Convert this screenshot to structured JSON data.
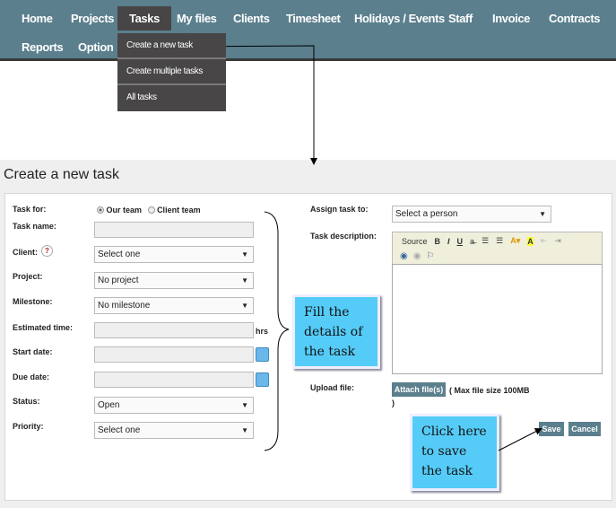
{
  "nav": {
    "items": [
      "Home",
      "Projects",
      "Tasks",
      "My files",
      "Clients",
      "Timesheet",
      "Holidays / Events",
      "Staff",
      "Invoice",
      "Contracts",
      "Reports",
      "Option"
    ],
    "active": "Tasks",
    "dropdown": [
      "Create a new task",
      "Create multiple tasks",
      "All tasks"
    ]
  },
  "page": {
    "title": "Create a new task"
  },
  "form": {
    "task_for": {
      "label": "Task for:",
      "options": [
        "Our team",
        "Client team"
      ],
      "selected": "Our team"
    },
    "task_name": {
      "label": "Task name:",
      "value": ""
    },
    "client": {
      "label": "Client:",
      "value": "Select one",
      "help": "?"
    },
    "project": {
      "label": "Project:",
      "value": "No project"
    },
    "milestone": {
      "label": "Milestone:",
      "value": "No milestone"
    },
    "estimated_time": {
      "label": "Estimated time:",
      "unit": "hrs",
      "value": ""
    },
    "start_date": {
      "label": "Start date:",
      "value": ""
    },
    "due_date": {
      "label": "Due date:",
      "value": ""
    },
    "status": {
      "label": "Status:",
      "value": "Open"
    },
    "priority": {
      "label": "Priority:",
      "value": "Select one"
    },
    "assign": {
      "label": "Assign task to:",
      "value": "Select a person"
    },
    "description": {
      "label": "Task description:",
      "toolbar": {
        "source": "Source",
        "bold": "B",
        "italic": "I",
        "underline": "U"
      }
    },
    "upload": {
      "label": "Upload file:",
      "button": "Attach file(s)",
      "note": "( Max file size 100MB",
      "note_end": ")"
    },
    "save": "Save",
    "cancel": "Cancel"
  },
  "callouts": {
    "fill": "Fill the details of the task",
    "save": "Click here to save the task"
  },
  "colors": {
    "nav": "#5b7f8d",
    "callout": "#55ccf8",
    "dropdown": "#484646"
  }
}
